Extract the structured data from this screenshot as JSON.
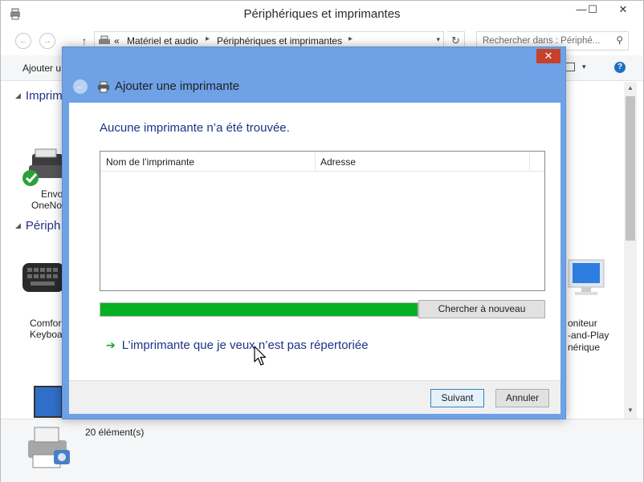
{
  "window": {
    "title": "Périphériques et imprimantes",
    "minimize": "—",
    "maximize": "☐",
    "close": "✕"
  },
  "address": {
    "back": "←",
    "forward": "→",
    "up": "↑",
    "overflow": "«",
    "crumbs": [
      "Matériel et audio",
      "Périphériques et imprimantes"
    ],
    "refresh": "↻",
    "search_placeholder": "Rechercher dans : Périphé..."
  },
  "commandbar": {
    "add": "Ajouter u",
    "help": "?"
  },
  "groups": {
    "printers": "Imprim",
    "devices": "Périph"
  },
  "devices": {
    "onenote_line1": "Envo",
    "onenote_line2": "OneNot",
    "keyboard_line1": "Comfor",
    "keyboard_line2": "Keyboa",
    "monitor_line1": "oniteur",
    "monitor_line2": "-and-Play",
    "monitor_line3": "nérique"
  },
  "status": {
    "count": "20 élément(s)"
  },
  "dialog": {
    "close": "✕",
    "title": "Ajouter une imprimante",
    "heading": "Aucune imprimante n’a été trouvée.",
    "columns": [
      "Nom de l’imprimante",
      "Adresse"
    ],
    "progress": 1.0,
    "search_again": "Chercher à nouveau",
    "not_listed_link": "L’imprimante que je veux n’est pas répertoriée",
    "next": "Suivant",
    "cancel": "Annuler"
  },
  "colors": {
    "dialog_frame": "#6ea1e6",
    "progress_fill": "#06b025",
    "heading_text": "#1e3287",
    "close_red": "#c7402b",
    "link_arrow": "#12a33a"
  }
}
